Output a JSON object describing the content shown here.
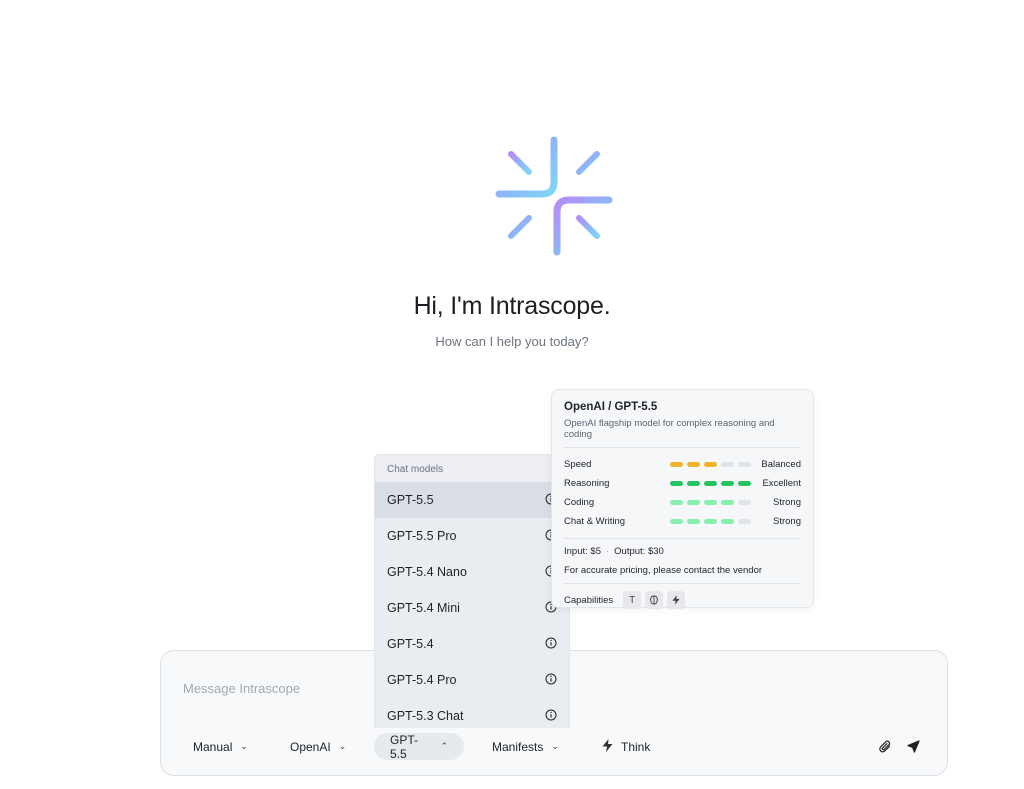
{
  "greeting": {
    "title": "Hi, I'm Intrascope.",
    "subtitle": "How can I help you today?"
  },
  "composer": {
    "placeholder": "Message Intrascope",
    "toolbar": {
      "mode": "Manual",
      "provider": "OpenAI",
      "model": "GPT-5.5",
      "manifests": "Manifests",
      "think": "Think"
    }
  },
  "model_menu": {
    "header": "Chat models",
    "items": [
      {
        "label": "GPT-5.5",
        "selected": true
      },
      {
        "label": "GPT-5.5 Pro"
      },
      {
        "label": "GPT-5.4 Nano"
      },
      {
        "label": "GPT-5.4 Mini"
      },
      {
        "label": "GPT-5.4"
      },
      {
        "label": "GPT-5.4 Pro"
      },
      {
        "label": "GPT-5.3 Chat"
      }
    ]
  },
  "model_card": {
    "title": "OpenAI / GPT-5.5",
    "description": "OpenAI flagship model for complex reasoning and coding",
    "metrics": [
      {
        "name": "Speed",
        "level": 3,
        "max": 5,
        "label": "Balanced",
        "color": "#f0b429"
      },
      {
        "name": "Reasoning",
        "level": 5,
        "max": 5,
        "label": "Excellent",
        "color": "#22c55e"
      },
      {
        "name": "Coding",
        "level": 4,
        "max": 5,
        "label": "Strong",
        "color": "#86efac"
      },
      {
        "name": "Chat & Writing",
        "level": 4,
        "max": 5,
        "label": "Strong",
        "color": "#86efac"
      }
    ],
    "input_price": "Input: $5",
    "output_price": "Output: $30",
    "pricing_note": "For accurate pricing, please contact the vendor",
    "capabilities_label": "Capabilities",
    "capabilities": [
      "text-icon",
      "brain-icon",
      "bolt-icon"
    ]
  },
  "colors": {
    "logo_gradient_start": "#a78bfa",
    "logo_gradient_end": "#7dd3fc"
  }
}
